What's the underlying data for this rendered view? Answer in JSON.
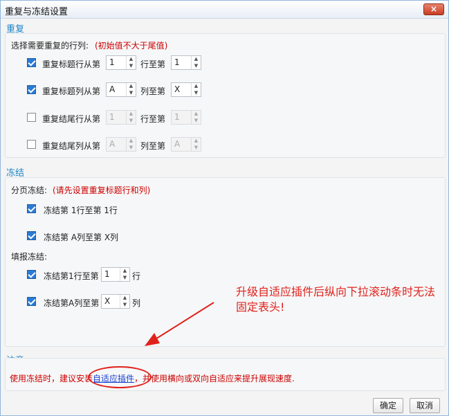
{
  "window": {
    "title": "重复与冻结设置",
    "close_label": "×"
  },
  "repeat": {
    "section_title": "重复",
    "prompt": "选择需要重复的行列:",
    "hint": "(初始值不大于尾值)",
    "rows": [
      {
        "label": "重复标题行从第",
        "checked": true,
        "from": "1",
        "mid_label": "行至第",
        "to": "1",
        "enabled": true
      },
      {
        "label": "重复标题列从第",
        "checked": true,
        "from": "A",
        "mid_label": "列至第",
        "to": "X",
        "enabled": true
      },
      {
        "label": "重复结尾行从第",
        "checked": false,
        "from": "1",
        "mid_label": "行至第",
        "to": "1",
        "enabled": false
      },
      {
        "label": "重复结尾列从第",
        "checked": false,
        "from": "A",
        "mid_label": "列至第",
        "to": "A",
        "enabled": false
      }
    ]
  },
  "freeze": {
    "section_title": "冻结",
    "paging_label": "分页冻结:",
    "paging_hint": "(请先设置重复标题行和列)",
    "paging_items": [
      {
        "label": "冻结第 1行至第 1行",
        "checked": true
      },
      {
        "label": "冻结第 A列至第 X列",
        "checked": true
      }
    ],
    "fill_label": "填报冻结:",
    "fill_row": {
      "prefix": "冻结第1行至第",
      "value": "1",
      "suffix": "行",
      "checked": true
    },
    "fill_col": {
      "prefix": "冻结第A列至第",
      "value": "X",
      "suffix": "列",
      "checked": true
    }
  },
  "note": {
    "section_title": "注意",
    "text_before": "使用冻结时，建议安装",
    "link": "自适应插件",
    "text_after": "，并使用横向或双向自适应来提升展现速度."
  },
  "annotation": "升级自适应插件后纵向下拉滚动条时无法固定表头!",
  "buttons": {
    "ok": "确定",
    "cancel": "取消"
  },
  "colors": {
    "section_title": "#1b86c8",
    "hint": "#cc0000",
    "annotation": "#e0221c",
    "checkbox": "#2a7bd4"
  }
}
